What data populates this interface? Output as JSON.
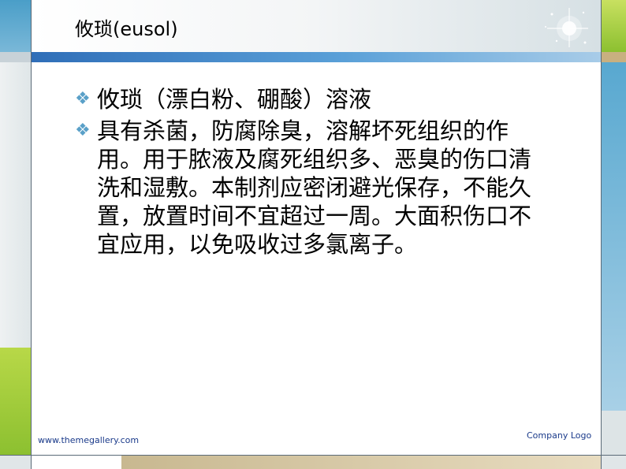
{
  "slide": {
    "title": "攸琐(eusol)",
    "bullets": [
      {
        "text": "攸琐（漂白粉、硼酸）溶液"
      },
      {
        "text": "具有杀菌，防腐除臭，溶解坏死组织的作用。用于脓液及腐死组织多、恶臭的伤口清洗和湿敷。本制剂应密闭避光保存，不能久置，放置时间不宜超过一周。大面积伤口不宜应用，以免吸收过多氯离子。"
      }
    ],
    "bullet_icon": "❖",
    "footer_url": "www.themegallery.com",
    "footer_logo": "Company Logo"
  },
  "colors": {
    "accent_blue": "#2f6eb8",
    "accent_green": "#8cc030",
    "bullet": "#5aa0c8"
  }
}
